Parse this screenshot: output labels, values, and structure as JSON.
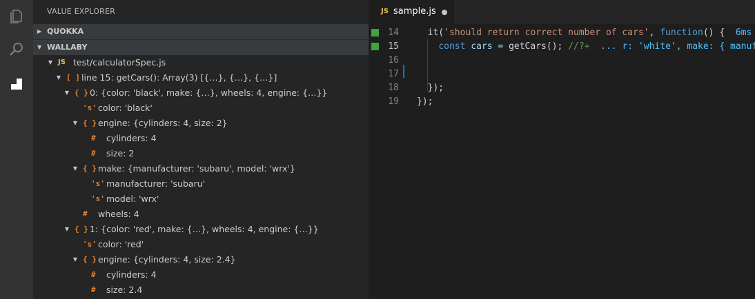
{
  "sidebar": {
    "title": "VALUE EXPLORER",
    "sections": [
      {
        "label": "QUOKKA",
        "expanded": false
      },
      {
        "label": "WALLABY",
        "expanded": true
      }
    ],
    "tree": [
      {
        "depth": 0,
        "twisty": "open",
        "icon": "js",
        "icon_text": "JS",
        "label": "test/calculatorSpec.js"
      },
      {
        "depth": 1,
        "twisty": "open",
        "icon": "array",
        "icon_text": "[ ]",
        "label": "line 15: getCars(): Array(3) [{…}, {…}, {…}]"
      },
      {
        "depth": 2,
        "twisty": "open",
        "icon": "object",
        "icon_text": "{ }",
        "label": "0: {color: 'black', make: {…}, wheels: 4, engine: {…}}"
      },
      {
        "depth": 3,
        "twisty": "none",
        "icon": "string",
        "icon_text": "'s'",
        "label": "color: 'black'"
      },
      {
        "depth": 3,
        "twisty": "open",
        "icon": "object",
        "icon_text": "{ }",
        "label": "engine: {cylinders: 4, size: 2}"
      },
      {
        "depth": 4,
        "twisty": "none",
        "icon": "number",
        "icon_text": "#",
        "label": "cylinders: 4"
      },
      {
        "depth": 4,
        "twisty": "none",
        "icon": "number",
        "icon_text": "#",
        "label": "size: 2"
      },
      {
        "depth": 3,
        "twisty": "open",
        "icon": "object",
        "icon_text": "{ }",
        "label": "make: {manufacturer: 'subaru', model: 'wrx'}"
      },
      {
        "depth": 4,
        "twisty": "none",
        "icon": "string",
        "icon_text": "'s'",
        "label": "manufacturer: 'subaru'"
      },
      {
        "depth": 4,
        "twisty": "none",
        "icon": "string",
        "icon_text": "'s'",
        "label": "model: 'wrx'"
      },
      {
        "depth": 3,
        "twisty": "none",
        "icon": "number",
        "icon_text": "#",
        "label": "wheels: 4"
      },
      {
        "depth": 2,
        "twisty": "open",
        "icon": "object",
        "icon_text": "{ }",
        "label": "1: {color: 'red', make: {…}, wheels: 4, engine: {…}}"
      },
      {
        "depth": 3,
        "twisty": "none",
        "icon": "string",
        "icon_text": "'s'",
        "label": "color: 'red'"
      },
      {
        "depth": 3,
        "twisty": "open",
        "icon": "object",
        "icon_text": "{ }",
        "label": "engine: {cylinders: 4, size: 2.4}"
      },
      {
        "depth": 4,
        "twisty": "none",
        "icon": "number",
        "icon_text": "#",
        "label": "cylinders: 4"
      },
      {
        "depth": 4,
        "twisty": "none",
        "icon": "number",
        "icon_text": "#",
        "label": "size: 2.4"
      }
    ]
  },
  "activity_bar": {
    "icons": [
      "files-icon",
      "search-icon",
      "wallaby-icon"
    ]
  },
  "editor": {
    "tab": {
      "badge": "JS",
      "name": "sample.js",
      "dirty": true
    },
    "lines": [
      {
        "num": "14",
        "marker": "green",
        "tokens": [
          {
            "t": "  it(",
            "c": "p"
          },
          {
            "t": "'should return correct number of cars'",
            "c": "s"
          },
          {
            "t": ", ",
            "c": "p"
          },
          {
            "t": "function",
            "c": "k"
          },
          {
            "t": "() {  ",
            "c": "p"
          },
          {
            "t": "6ms",
            "c": "t"
          }
        ]
      },
      {
        "num": "15",
        "marker": "green",
        "current": true,
        "tokens": [
          {
            "t": "    ",
            "c": "p"
          },
          {
            "t": "const",
            "c": "k"
          },
          {
            "t": " cars = ",
            "c": "v"
          },
          {
            "t": "getCars",
            "c": "p"
          },
          {
            "t": "(); ",
            "c": "p"
          },
          {
            "t": "//?+",
            "c": "c"
          },
          {
            "t": "  ... r: 'white', make: { manufa",
            "c": "t"
          }
        ]
      },
      {
        "num": "16",
        "tokens": []
      },
      {
        "num": "17",
        "tokens": []
      },
      {
        "num": "18",
        "tokens": [
          {
            "t": "  });",
            "c": "p"
          }
        ]
      },
      {
        "num": "19",
        "tokens": [
          {
            "t": "});",
            "c": "p"
          }
        ]
      }
    ],
    "colors": {
      "marker": "#3fa33f",
      "accent": "#0a7aca"
    }
  }
}
